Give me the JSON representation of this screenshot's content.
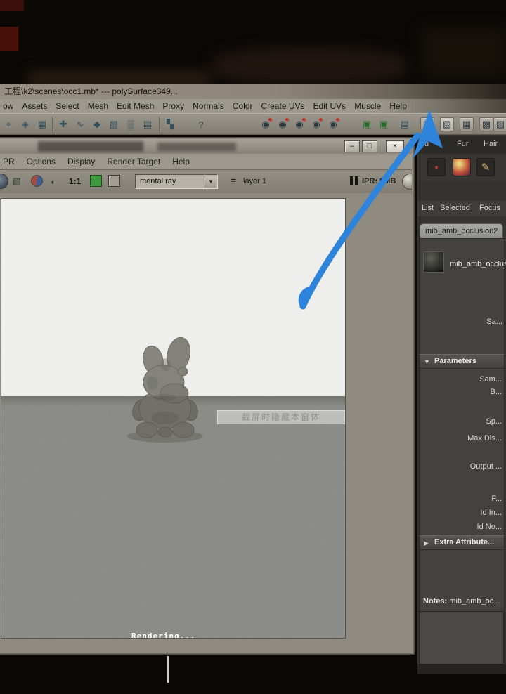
{
  "maya": {
    "title": "工程\\k2\\scenes\\occ1.mb*   ---   polySurface349...",
    "menus": [
      "ow",
      "Assets",
      "Select",
      "Mesh",
      "Edit Mesh",
      "Proxy",
      "Normals",
      "Color",
      "Create UVs",
      "Edit UVs",
      "Muscle",
      "Help"
    ],
    "status_icons": [
      {
        "name": "select-mask-icon",
        "glyph": "⌖"
      },
      {
        "name": "hierarchy-mask-icon",
        "glyph": "◈"
      },
      {
        "name": "object-mask-icon",
        "glyph": "▦"
      },
      {
        "name": "snap-grid-icon",
        "glyph": "✚"
      },
      {
        "name": "snap-curve-icon",
        "glyph": "∿"
      },
      {
        "name": "snap-point-icon",
        "glyph": "◆"
      },
      {
        "name": "snap-plane-icon",
        "glyph": "▨"
      },
      {
        "name": "make-live-icon",
        "glyph": "▒"
      },
      {
        "name": "construction-history-icon",
        "glyph": "▤"
      },
      {
        "name": "inputs-icon",
        "glyph": "▚"
      },
      {
        "name": "help-icon",
        "glyph": "?"
      },
      {
        "name": "render-flag-1-icon",
        "glyph": "◉"
      },
      {
        "name": "render-flag-2-icon",
        "glyph": "◉"
      },
      {
        "name": "render-flag-3-icon",
        "glyph": "◉"
      },
      {
        "name": "render-flag-4-icon",
        "glyph": "◉"
      },
      {
        "name": "render-flag-5-icon",
        "glyph": "◉"
      },
      {
        "name": "quick-layout-1-icon",
        "glyph": "▣"
      },
      {
        "name": "quick-layout-2-icon",
        "glyph": "▣"
      },
      {
        "name": "clipboard-icon",
        "glyph": "▤"
      },
      {
        "name": "hypergraph-icon",
        "glyph": "▥"
      },
      {
        "name": "hypershade-icon",
        "glyph": "▧"
      },
      {
        "name": "render-view-icon",
        "glyph": "▦"
      },
      {
        "name": "render-current-frame-icon",
        "glyph": "▩"
      },
      {
        "name": "render-settings-icon",
        "glyph": "▨"
      }
    ]
  },
  "render_view": {
    "menus": [
      "PR",
      "Options",
      "Display",
      "Render Target",
      "Help"
    ],
    "window_buttons": {
      "minimize": "–",
      "maximize": "□",
      "close": "×"
    },
    "toolbar": {
      "zoom": "1:1",
      "renderer": "mental ray",
      "dropdown_arrow": "▼",
      "layer": "layer 1",
      "ipr_status": "IPR: 0MB",
      "icons": [
        {
          "name": "render-region-icon",
          "glyph": "▧"
        },
        {
          "name": "snapshot-icon",
          "glyph": "◐"
        },
        {
          "name": "rgb-channels-toggle",
          "glyph": ""
        },
        {
          "name": "alpha-channel-toggle",
          "glyph": ""
        },
        {
          "name": "layers-icon",
          "glyph": "≡"
        },
        {
          "name": "color-swatch",
          "glyph": ""
        }
      ]
    },
    "watermark": "截屏时隐藏本窗体",
    "progress": "Rendering..."
  },
  "shelf": {
    "tabs": [
      "u",
      "Fur",
      "Hair"
    ],
    "icons": [
      {
        "name": "shelf-muscle-icon",
        "glyph": "▪"
      },
      {
        "name": "shelf-shading-ball-icon",
        "glyph": ""
      },
      {
        "name": "shelf-paintbrush-icon",
        "glyph": "✎"
      }
    ]
  },
  "attribute_editor": {
    "menus": [
      "List",
      "Selected",
      "Focus"
    ],
    "tab": "mib_amb_occlusion2",
    "node_name": "mib_amb_occlus...",
    "sample_label": "Sa...",
    "sections": {
      "parameters": "Parameters",
      "extra_attributes": "Extra Attribute..."
    },
    "tri_open": "▼",
    "tri_closed": "▶",
    "params": [
      "Sam...",
      "B...",
      "Sp...",
      "Max Dis...",
      "Output ...",
      "F...",
      "Id In...",
      "Id No..."
    ],
    "notes_label": "Notes:",
    "notes_value": "mib_amb_oc..."
  },
  "colors": {
    "annotation_arrow": "#2e84da",
    "render_floor": "#a7a7a2",
    "panel_bg": "#35332f"
  }
}
